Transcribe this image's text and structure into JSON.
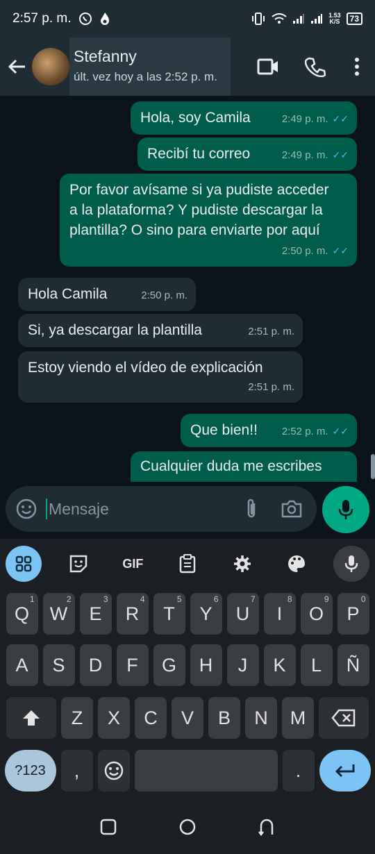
{
  "status_bar": {
    "time": "2:57 p. m.",
    "net_speed_top": "1.53",
    "net_speed_bottom": "K/S",
    "battery": "73"
  },
  "header": {
    "contact_name": "Stefanny",
    "last_seen": "últ. vez hoy a las 2:52 p. m."
  },
  "messages": [
    {
      "dir": "out",
      "text": "Hola, soy Camila",
      "time": "2:49 p. m."
    },
    {
      "dir": "out",
      "text": "Recibí tu correo",
      "time": "2:49 p. m."
    },
    {
      "dir": "out",
      "text": "Por favor avísame si ya pudiste acceder a la plataforma? Y pudiste descargar la plantilla? O sino para enviarte por aquí",
      "time": "2:50 p. m."
    },
    {
      "dir": "in",
      "text": "Hola Camila",
      "time": "2:50 p. m."
    },
    {
      "dir": "in",
      "text": "Si, ya descargar la plantilla",
      "time": "2:51 p. m."
    },
    {
      "dir": "in",
      "text": "Estoy viendo el vídeo de explicación",
      "time": "2:51 p. m."
    },
    {
      "dir": "out",
      "text": "Que bien!!",
      "time": "2:52 p. m."
    },
    {
      "dir": "out",
      "text": "Cualquier duda me escribes",
      "time": ""
    }
  ],
  "input": {
    "placeholder": "Mensaje"
  },
  "keyboard": {
    "toolbar": [
      "apps",
      "sticker",
      "GIF",
      "clipboard",
      "settings",
      "theme",
      "voice"
    ],
    "gif_label": "GIF",
    "row1": [
      {
        "k": "Q",
        "h": "1"
      },
      {
        "k": "W",
        "h": "2"
      },
      {
        "k": "E",
        "h": "3"
      },
      {
        "k": "R",
        "h": "4"
      },
      {
        "k": "T",
        "h": "5"
      },
      {
        "k": "Y",
        "h": "6"
      },
      {
        "k": "U",
        "h": "7"
      },
      {
        "k": "I",
        "h": "8"
      },
      {
        "k": "O",
        "h": "9"
      },
      {
        "k": "P",
        "h": "0"
      }
    ],
    "row2": [
      "A",
      "S",
      "D",
      "F",
      "G",
      "H",
      "J",
      "K",
      "L",
      "Ñ"
    ],
    "row3": [
      "Z",
      "X",
      "C",
      "V",
      "B",
      "N",
      "M"
    ],
    "sym_label": "?123",
    "comma": ",",
    "period": "."
  },
  "colors": {
    "outgoing": "#005c4b",
    "incoming": "#202c33",
    "accent": "#00a884",
    "read_ticks": "#53bdeb"
  }
}
